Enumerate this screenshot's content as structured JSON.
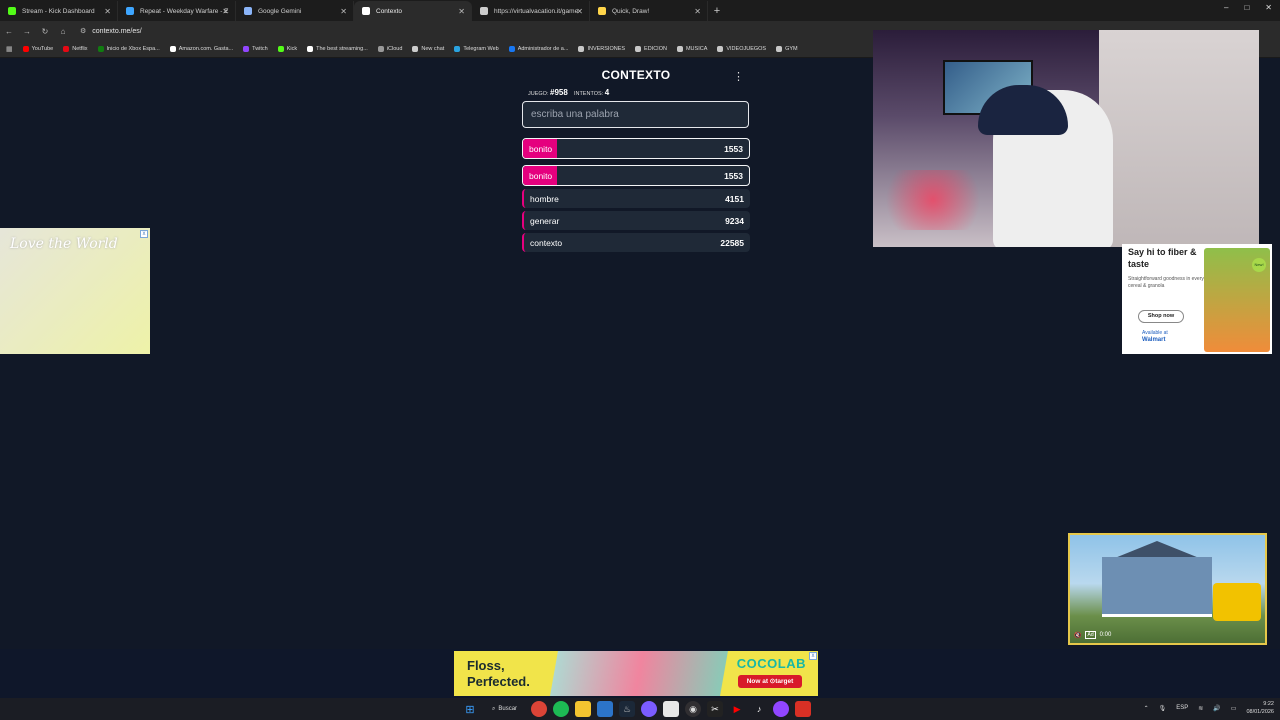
{
  "browser": {
    "tabs": [
      {
        "title": "Stream - Kick Dashboard",
        "color": "#53fc18",
        "active": false
      },
      {
        "title": "Repeat - Weekday Warfare - E",
        "color": "#3ea6ff",
        "active": false
      },
      {
        "title": "Google Gemini",
        "color": "#8ab4f8",
        "active": false
      },
      {
        "title": "Contexto",
        "color": "#ffffff",
        "active": true
      },
      {
        "title": "https://virtualvacation.it/game",
        "color": "#cccccc",
        "active": false
      },
      {
        "title": "Quick, Draw!",
        "color": "#ffd54a",
        "active": false
      }
    ],
    "new_tab": "+",
    "window_controls": {
      "minimize": "–",
      "maximize": "□",
      "close": "✕"
    },
    "nav": {
      "back": "←",
      "forward": "→",
      "reload": "↻",
      "home": "⌂"
    },
    "url": "contexto.me/es/",
    "bookmarks": [
      {
        "label": "YouTube",
        "color": "#ff0000"
      },
      {
        "label": "Netflix",
        "color": "#e50914"
      },
      {
        "label": "Inicio de Xbox Espa...",
        "color": "#107c10"
      },
      {
        "label": "Amazon.com. Gasta...",
        "color": "#ffffff"
      },
      {
        "label": "Twitch",
        "color": "#9146ff"
      },
      {
        "label": "Kick",
        "color": "#53fc18"
      },
      {
        "label": "The best streaming...",
        "color": "#ffffff"
      },
      {
        "label": "iCloud",
        "color": "#999999"
      },
      {
        "label": "New chat",
        "color": "#cccccc"
      },
      {
        "label": "Telegram Web",
        "color": "#2aa3e0"
      },
      {
        "label": "Administrador de a...",
        "color": "#1877f2"
      },
      {
        "label": "INVERSIONES",
        "color": "#c8c8c8"
      },
      {
        "label": "EDICION",
        "color": "#c8c8c8"
      },
      {
        "label": "MUSICA",
        "color": "#c8c8c8"
      },
      {
        "label": "VIDEOJUEGOS",
        "color": "#c8c8c8"
      },
      {
        "label": "GYM",
        "color": "#c8c8c8"
      }
    ]
  },
  "game": {
    "title": "CONTEXTO",
    "menu": "⋮",
    "stats": {
      "game_label": "JUEGO:",
      "game_value": "#958",
      "attempts_label": "INTENTOS:",
      "attempts_value": "4"
    },
    "input_placeholder": "escriba una palabra",
    "last_guess": {
      "word": "bonito",
      "rank": "1553",
      "fill_fraction": 0.15
    },
    "guesses": [
      {
        "word": "bonito",
        "rank": "1553",
        "fill_fraction": 0.15,
        "style": "outlined"
      },
      {
        "word": "hombre",
        "rank": "4151",
        "fill_fraction": 0.0,
        "style": "plain"
      },
      {
        "word": "generar",
        "rank": "9234",
        "fill_fraction": 0.0,
        "style": "plain"
      },
      {
        "word": "contexto",
        "rank": "22585",
        "fill_fraction": 0.0,
        "style": "plain"
      }
    ],
    "accent_color": "#e5007e"
  },
  "ads": {
    "left": {
      "logo": "Love the World",
      "close": "x"
    },
    "right": {
      "headline": "Say hi to fiber & taste",
      "body": "Straightforward goodness in every cereal & granola",
      "cta": "Shop now",
      "availability": "Available at",
      "retailer": "Walmart",
      "badge": "New!"
    },
    "video": {
      "time": "0:00",
      "ad_label": "Ad"
    },
    "bottom": {
      "headline_1": "Floss,",
      "headline_2": "Perfected.",
      "brand": "COCOLAB",
      "cta": "Now at ⊙target",
      "close": "x"
    }
  },
  "taskbar": {
    "search_label": "Buscar",
    "language": "ESP",
    "time": "9:22",
    "date": "08/01/2026"
  }
}
